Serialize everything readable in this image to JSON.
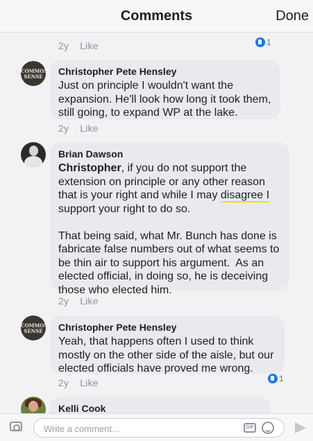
{
  "header": {
    "title": "Comments",
    "done_label": "Done"
  },
  "comments": [
    {
      "age": "2y",
      "like_label": "Like",
      "reaction_count": "1"
    },
    {
      "author": "Christopher Pete Hensley",
      "avatar_text": "COMMON\nSENSE",
      "text": "Just on principle I wouldn't want the\nexpansion. He'll look how long it took them,\nstill going, to expand WP at the lake.",
      "age": "2y",
      "like_label": "Like"
    },
    {
      "author": "Brian Dawson",
      "mention": "Christopher",
      "text_a": ", if you do not support the\nextension on principle or any other reason\nthat is your right and while I may ",
      "highlight": "disagree I",
      "text_b": "\nsupport your right to do so.\n\nThat being said, what Mr. Bunch has done is\nfabricate false numbers out of what seems to\nbe thin air to support his argument.  As an\nelected official, in doing so, he is deceiving\nthose who elected him.",
      "age": "2y",
      "like_label": "Like"
    },
    {
      "author": "Christopher Pete Hensley",
      "avatar_text": "COMMON\nSENSE",
      "text": "Yeah, that happens often I used to think\nmostly on the other side of the aisle, but our\nelected officials have proved me wrong.",
      "age": "2y",
      "like_label": "Like",
      "reaction_count": "1"
    },
    {
      "author": "Kelli Cook"
    }
  ],
  "composer": {
    "placeholder": "Write a comment...",
    "gif_label": "GIF"
  },
  "colors": {
    "link_blue": "#1877f2",
    "highlight_yellow": "#f2e200",
    "bubble_gray": "#e9eaee"
  }
}
